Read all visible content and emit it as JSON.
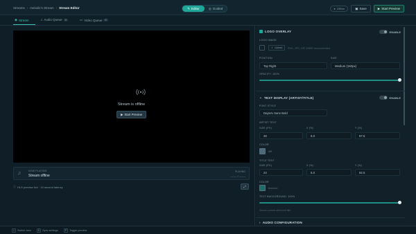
{
  "breadcrumb": {
    "item1": "Streams",
    "item2": "melodic's Stream",
    "current": "Stream Editor"
  },
  "mode": {
    "editor": "Editor",
    "guided": "Guided"
  },
  "header": {
    "status": "Offline",
    "save": "Save",
    "start": "Start Preview"
  },
  "tabs": [
    {
      "label": "Stream",
      "count": ""
    },
    {
      "label": "Audio Queue",
      "count": "0"
    },
    {
      "label": "Video Queue",
      "count": "0"
    }
  ],
  "preview": {
    "offline_title": "Stream is offline",
    "start_button": "Start Preview"
  },
  "now_playing": {
    "label": "NOW PLAYING",
    "value": "Stream offline",
    "right_label": "PLAYING",
    "right_value": "—:— / —:—"
  },
  "hls_line": "HLS preview live · 10 second latency",
  "logo_overlay": {
    "title": "LOGO OVERLAY",
    "enable_label": "ENABLE",
    "image_label": "LOGO IMAGE",
    "upload_button": "Upload",
    "upload_hint": "PNG, JPG, GIF, WEBP recommended",
    "position_label": "POSITION",
    "position_value": "Top Right",
    "size_label": "SIZE",
    "size_value": "Medium (150px)",
    "opacity_label": "OPACITY: 100%",
    "opacity": 1.0
  },
  "text_display": {
    "title": "TEXT DISPLAY (ARTIST/TITLE)",
    "enable_label": "ENABLE",
    "font_style_label": "FONT STYLE",
    "font_style_value": "DejaVu Sans Bold",
    "artist_text_label": "ARTIST TEXT",
    "artist_size_label": "SIZE (PX)",
    "artist_size": "28",
    "artist_x_label": "X (%)",
    "artist_x": "5.0",
    "artist_y_label": "Y (%)",
    "artist_y": "87.5",
    "artist_color_label": "COLOR",
    "artist_color": "#4e6a78",
    "artist_color_hex": "#fff",
    "title_text_label": "TITLE TEXT",
    "title_size_label": "SIZE (PX)",
    "title_size": "24",
    "title_x_label": "X (%)",
    "title_x": "5.0",
    "title_y_label": "Y (%)",
    "title_y": "92.5",
    "title_color_label": "COLOR",
    "title_color": "#1a6e68",
    "title_color_hex": "#cccccc",
    "bg_opacity_label": "TEXT BACKGROUND: 100%",
    "bg_opacity": 1.0,
    "hint": "Shows current artist and title"
  },
  "audio_config": {
    "title": "AUDIO CONFIGURATION"
  },
  "footer": {
    "shortcut1_key": "1",
    "shortcut1_label": "Switch view",
    "shortcut2_key": "S",
    "shortcut2_label": "Sync settings",
    "shortcut3_key": "P",
    "shortcut3_label": "Toggle preview"
  }
}
